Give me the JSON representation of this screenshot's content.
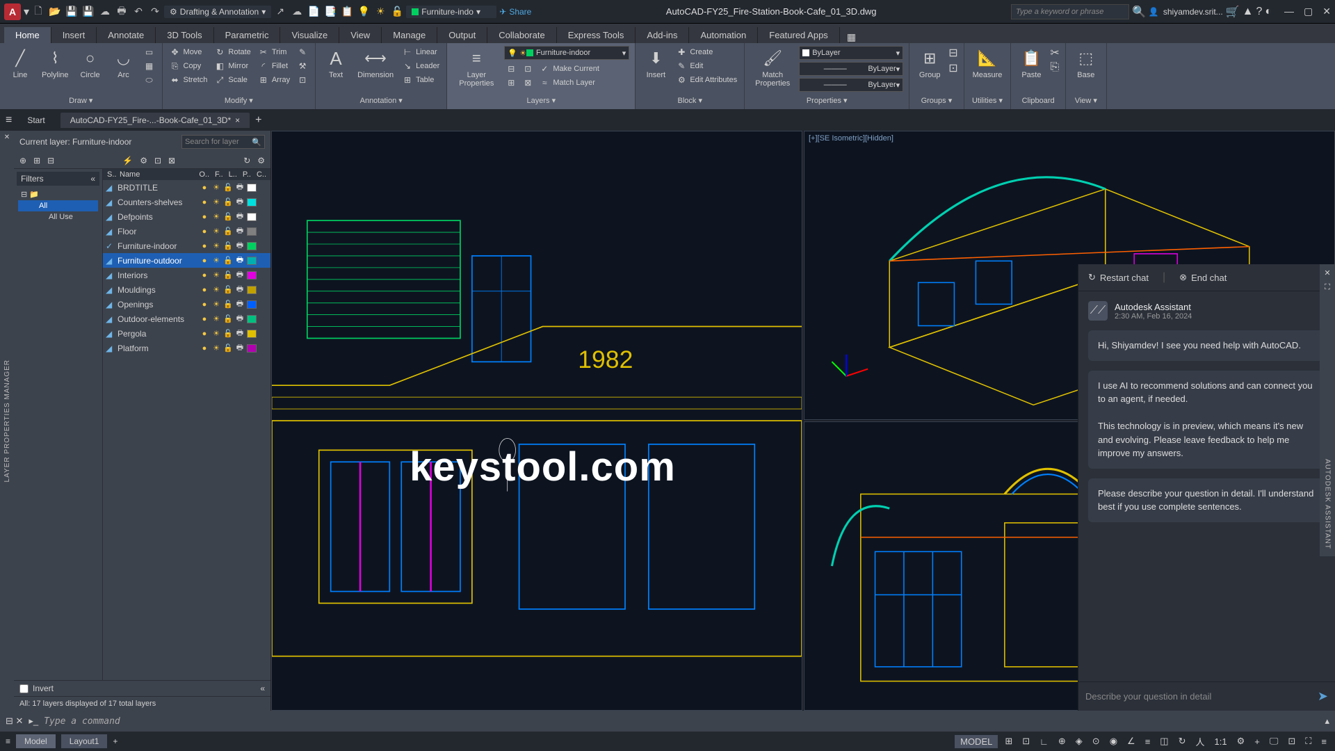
{
  "title": "AutoCAD-FY25_Fire-Station-Book-Cafe_01_3D.dwg",
  "workspace": "Drafting & Annotation",
  "layer_dropdown": "Furniture-indo",
  "share": "Share",
  "search_placeholder": "Type a keyword or phrase",
  "user": "shiyamdev.srit...",
  "ribbon_tabs": [
    "Home",
    "Insert",
    "Annotate",
    "3D Tools",
    "Parametric",
    "Visualize",
    "View",
    "Manage",
    "Output",
    "Collaborate",
    "Express Tools",
    "Add-ins",
    "Automation",
    "Featured Apps"
  ],
  "active_ribbon_tab": "Home",
  "panels": {
    "draw": {
      "label": "Draw ▾",
      "items": [
        "Line",
        "Polyline",
        "Circle",
        "Arc"
      ]
    },
    "modify": {
      "label": "Modify ▾",
      "items": [
        "Move",
        "Copy",
        "Stretch",
        "Rotate",
        "Mirror",
        "Scale",
        "Trim",
        "Fillet",
        "Array"
      ]
    },
    "annotation": {
      "label": "Annotation ▾",
      "text": "Text",
      "dim": "Dimension",
      "items": [
        "Linear",
        "Leader",
        "Table"
      ]
    },
    "layers": {
      "label": "Layers ▾",
      "lp": "Layer Properties",
      "current": "Furniture-indoor",
      "items": [
        "Make Current",
        "Match Layer"
      ]
    },
    "block": {
      "label": "Block ▾",
      "ins": "Insert",
      "items": [
        "Create",
        "Edit",
        "Edit Attributes"
      ]
    },
    "properties": {
      "label": "Properties ▾",
      "match": "Match Properties",
      "p1": "ByLayer",
      "p2": "ByLayer",
      "p3": "ByLayer"
    },
    "groups": {
      "label": "Groups ▾",
      "g": "Group"
    },
    "utilities": {
      "label": "Utilities ▾",
      "m": "Measure"
    },
    "clipboard": {
      "label": "Clipboard",
      "p": "Paste"
    },
    "view": {
      "label": "View ▾",
      "b": "Base"
    }
  },
  "doc_tabs": {
    "start": "Start",
    "file": "AutoCAD-FY25_Fire-...-Book-Cafe_01_3D*"
  },
  "layer_panel": {
    "side_title": "LAYER PROPERTIES MANAGER",
    "current": "Current layer: Furniture-indoor",
    "search": "Search for layer",
    "filters_label": "Filters",
    "tree": {
      "all": "All",
      "used": "All Use"
    },
    "headers": [
      "S..",
      "Name",
      "O..",
      "F..",
      "L..",
      "P..",
      "C.."
    ],
    "invert": "Invert",
    "status": "All: 17 layers displayed of 17 total layers",
    "layers": [
      {
        "name": "BRDTITLE",
        "color": "#ffffff",
        "chk": true
      },
      {
        "name": "Counters-shelves",
        "color": "#00e0e0",
        "chk": true
      },
      {
        "name": "Defpoints",
        "color": "#ffffff",
        "chk": true
      },
      {
        "name": "Floor",
        "color": "#808080",
        "chk": true
      },
      {
        "name": "Furniture-indoor",
        "color": "#00d060",
        "chk": true,
        "current": true
      },
      {
        "name": "Furniture-outdoor",
        "color": "#00b0b0",
        "chk": true,
        "sel": true
      },
      {
        "name": "Interiors",
        "color": "#e000e0",
        "chk": true
      },
      {
        "name": "Mouldings",
        "color": "#c0a000",
        "chk": true
      },
      {
        "name": "Openings",
        "color": "#0060ff",
        "chk": true
      },
      {
        "name": "Outdoor-elements",
        "color": "#00c080",
        "chk": true
      },
      {
        "name": "Pergola",
        "color": "#e0c000",
        "chk": true
      },
      {
        "name": "Platform",
        "color": "#b000b0",
        "chk": true
      }
    ]
  },
  "viewport_label": "[+][SE Isometric][Hidden]",
  "year_text": "1982",
  "watermark": "keystool.com",
  "cmd_prompt": "Type a command",
  "bottom": {
    "model": "Model",
    "layout": "Layout1",
    "space": "MODEL",
    "scale": "1:1"
  },
  "chat": {
    "restart": "Restart chat",
    "end": "End chat",
    "name": "Autodesk Assistant",
    "time": "2:30 AM, Feb 16, 2024",
    "msg1": "Hi, Shiyamdev! I see you need help with AutoCAD.",
    "msg2a": "I use AI to recommend solutions and can connect you to an agent, if needed.",
    "msg2b": "This technology is in preview, which means it's new and evolving. Please leave feedback to help me improve my answers.",
    "msg3": "Please describe your question in detail. I'll understand best if you use complete sentences.",
    "placeholder": "Describe your question in detail",
    "side": "AUTODESK ASSISTANT"
  }
}
